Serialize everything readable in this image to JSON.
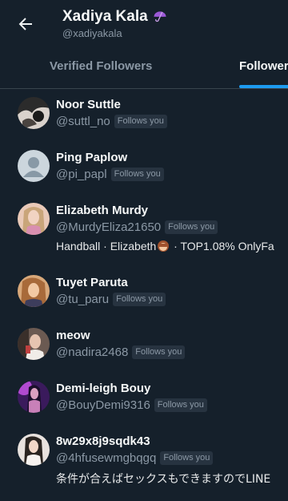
{
  "header": {
    "title": "Xadiya Kala",
    "handle": "@xadiyakala",
    "title_icon": "umbrella-icon",
    "back_icon": "back-arrow-icon"
  },
  "tabs": [
    {
      "label": "Verified Followers",
      "selected": false
    },
    {
      "label": "Follower",
      "selected": true
    }
  ],
  "colors": {
    "background": "#15202b",
    "accent": "#1d9bf0",
    "secondary_text": "#8b98a5",
    "divider": "#38444d"
  },
  "followers": [
    {
      "name": "Noor Suttle",
      "handle": "@suttl_no",
      "badge": "Follows you"
    },
    {
      "name": "Ping Paplow",
      "handle": "@pi_papl",
      "badge": "Follows you"
    },
    {
      "name": "Elizabeth Murdy",
      "handle": "@MurdyEliza21650",
      "badge": "Follows you",
      "bio_part1": "Handball · Elizabeth",
      "bio_part2": " · TOP1.08% OnlyFa",
      "bio_emoji": "see-no-evil-monkey-icon"
    },
    {
      "name": "Tuyet Paruta",
      "handle": "@tu_paru",
      "badge": "Follows you"
    },
    {
      "name": "meow",
      "handle": "@nadira2468",
      "badge": "Follows you"
    },
    {
      "name": "Demi-leigh Bouy",
      "handle": "@BouyDemi9316",
      "badge": "Follows you"
    },
    {
      "name": "8w29x8j9sqdk43",
      "handle": "@4hfusewmgbqgq",
      "badge": "Follows you",
      "bio": "条件が合えばセックスもできますのでLINE"
    }
  ]
}
